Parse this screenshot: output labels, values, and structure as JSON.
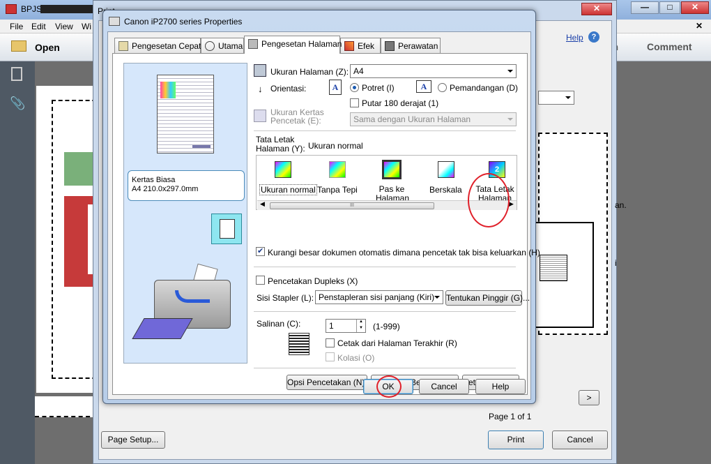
{
  "app": {
    "title": "BPJS-C",
    "menu": [
      "File",
      "Edit",
      "View",
      "Wi"
    ],
    "open_label": "Open",
    "right_tools": [
      "gn",
      "Comment"
    ],
    "help_label": "Help",
    "page_label": "Page 1 of 1",
    "doc_text": [
      "an.",
      "i"
    ]
  },
  "printdlg": {
    "title": "Print",
    "page_setup": "Page Setup...",
    "print": "Print",
    "cancel": "Cancel",
    "next": ">"
  },
  "props": {
    "title": "Canon iP2700 series Properties",
    "tabs": [
      "Pengesetan Cepat",
      "Utama",
      "Pengesetan Halaman",
      "Efek",
      "Perawatan"
    ],
    "paper_info": [
      "Kertas Biasa",
      "A4 210.0x297.0mm"
    ],
    "ukuran_label": "Ukuran Halaman (Z):",
    "ukuran_value": "A4",
    "orientasi_label": "Orientasi:",
    "potret": "Potret (I)",
    "pemandangan": "Pemandangan (D)",
    "putar": "Putar 180 derajat (1)",
    "ukuran_kertas_label": [
      "Ukuran Kertas",
      "Pencetak (E):"
    ],
    "ukuran_kertas_value": "Sama dengan Ukuran Halaman",
    "tata_label": [
      "Tata Letak",
      "Halaman (Y):"
    ],
    "tata_value": "Ukuran normal",
    "layouts": [
      "Ukuran normal",
      "Tanpa Tepi",
      "Pas ke Halaman",
      "Berskala",
      "Tata Letak Halaman"
    ],
    "scroll_grip": "III",
    "kurangi": "Kurangi besar dokumen otomatis dimana pencetak tak bisa keluarkan (H)",
    "duplex": "Pencetakan Dupleks (X)",
    "stapler_label": "Sisi Stapler (L):",
    "stapler_value": "Penstapleran sisi panjang (Kiri)",
    "tentukan": "Tentukan Pinggir (G)...",
    "salinan_label": "Salinan (C):",
    "salinan_value": "1",
    "salinan_range": "(1-999)",
    "cetak_akhir": "Cetak dari Halaman Terakhir (R)",
    "kolasi": "Kolasi (O)",
    "opsi": "Opsi Pencetakan (N)...",
    "cap": "Cap/Latar Belakang (K)...",
    "setelan": "Setelan Asal (F)",
    "ok": "OK",
    "cancel": "Cancel",
    "help": "Help"
  }
}
